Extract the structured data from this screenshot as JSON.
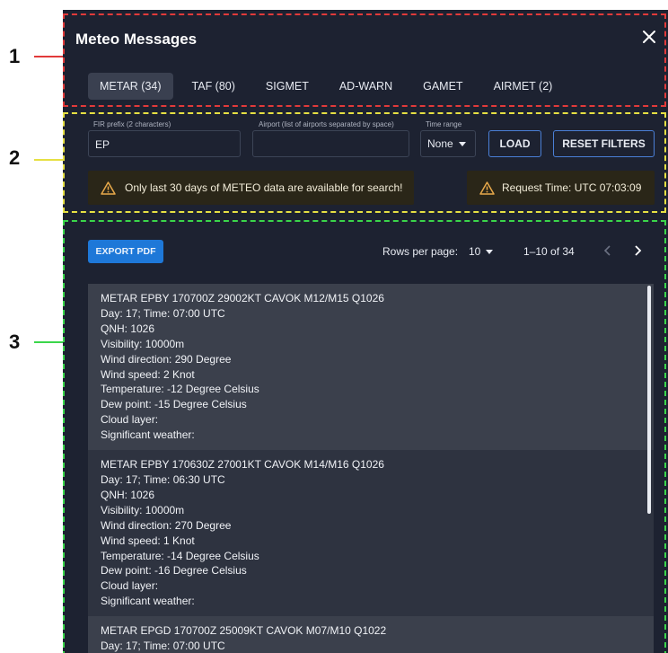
{
  "callouts": [
    "1",
    "2",
    "3"
  ],
  "header": {
    "title": "Meteo Messages"
  },
  "tabs": [
    {
      "label": "METAR (34)",
      "active": true
    },
    {
      "label": "TAF (80)"
    },
    {
      "label": "SIGMET"
    },
    {
      "label": "AD-WARN"
    },
    {
      "label": "GAMET"
    },
    {
      "label": "AIRMET (2)"
    }
  ],
  "filters": {
    "fir_label": "FIR prefix (2 characters)",
    "fir_value": "EP",
    "airport_label": "Airport (list of airports separated by space)",
    "airport_value": "",
    "time_label": "Time range",
    "time_value": "None",
    "load_label": "LOAD",
    "reset_label": "RESET FILTERS",
    "warning": "Only last 30 days of METEO data are available for search!",
    "request_time": "Request Time: UTC 07:03:09"
  },
  "toolbar": {
    "export_label": "EXPORT PDF",
    "rows_per_page_label": "Rows per page:",
    "rows_per_page_value": "10",
    "range_text": "1–10 of 34"
  },
  "messages": [
    {
      "header": "METAR EPBY 170700Z 29002KT CAVOK M12/M15 Q1026",
      "day_time": "Day: 17; Time: 07:00 UTC",
      "qnh": "QNH: 1026",
      "visibility": "Visibility: 10000m",
      "wind_direction": "Wind direction: 290 Degree",
      "wind_speed": "Wind speed: 2 Knot",
      "temperature": "Temperature: -12  Degree Celsius",
      "dew_point": "Dew point: -15  Degree Celsius",
      "cloud": "Cloud layer:",
      "weather": "Significant weather:"
    },
    {
      "header": "METAR EPBY 170630Z 27001KT CAVOK M14/M16 Q1026",
      "day_time": "Day: 17; Time: 06:30 UTC",
      "qnh": "QNH: 1026",
      "visibility": "Visibility: 10000m",
      "wind_direction": "Wind direction: 270 Degree",
      "wind_speed": "Wind speed: 1 Knot",
      "temperature": "Temperature: -14  Degree Celsius",
      "dew_point": "Dew point: -16  Degree Celsius",
      "cloud": "Cloud layer:",
      "weather": "Significant weather:"
    },
    {
      "header": "METAR EPGD 170700Z 25009KT CAVOK M07/M10 Q1022",
      "day_time": "Day: 17; Time: 07:00 UTC"
    }
  ],
  "colors": {
    "panel_bg": "#1d2231",
    "zone_1": "#e23a3a",
    "zone_2": "#e6e043",
    "zone_3": "#3ad64a",
    "accent": "#1e78d8",
    "warning_icon": "#e8a94a"
  },
  "icons": {
    "close": "close-icon",
    "warning": "warning-icon",
    "dropdown": "chevron-down-icon",
    "prev": "chevron-left-icon",
    "next": "chevron-right-icon"
  }
}
